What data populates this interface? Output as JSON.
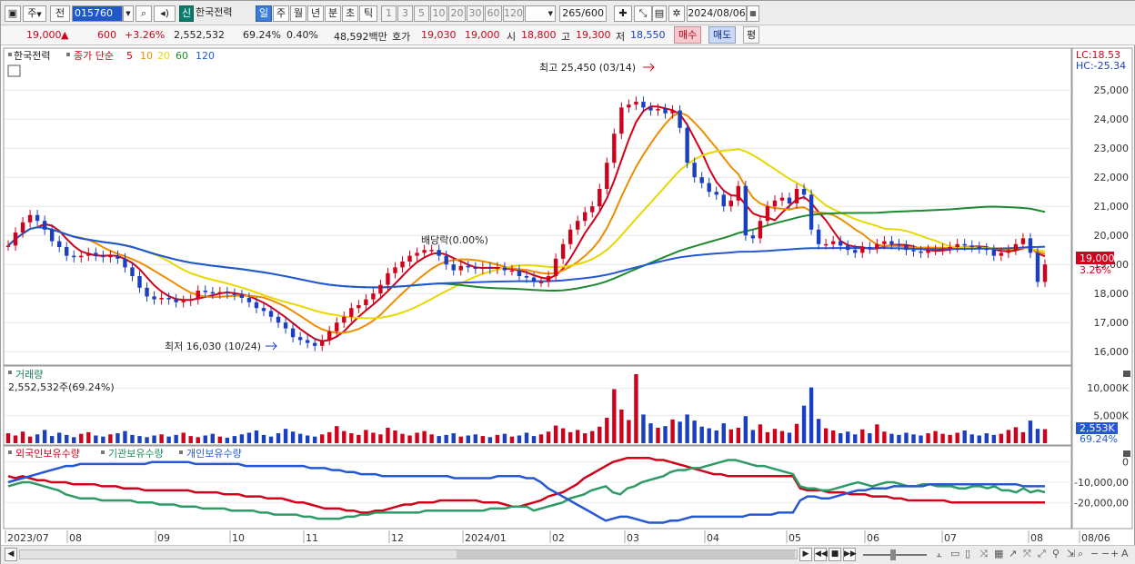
{
  "toolbar": {
    "cycle": "주",
    "jeon": "전",
    "code": "015760",
    "shin": "신",
    "stock_name": "한국전력",
    "periods": [
      "일",
      "주",
      "월",
      "년",
      "분",
      "초",
      "틱"
    ],
    "active_period": "일",
    "counts": [
      "1",
      "3",
      "5",
      "10",
      "20",
      "30",
      "60",
      "120"
    ],
    "view_count": "265",
    "view_total": "/600",
    "date": "2024/08/06"
  },
  "info": {
    "price": "19,000",
    "arrow": "▲",
    "change": "600",
    "change_pct": "+3.26%",
    "volume": "2,552,532",
    "vol_ratio": "69.24%",
    "turnover": "0.40%",
    "amount": "48,592백만",
    "hoga_label": "호가",
    "hoga1": "19,030",
    "hoga2": "19,000",
    "open_label": "시",
    "open": "18,800",
    "high_label": "고",
    "high": "19,300",
    "low_label": "저",
    "low": "18,550",
    "buy": "매수",
    "sell": "매도",
    "pyeong": "평"
  },
  "legend": {
    "name": "한국전력",
    "ma_label": "종가 단순",
    "ma_periods": [
      "5",
      "10",
      "20",
      "60",
      "120"
    ],
    "ma_colors": [
      "#d0021b",
      "#f08c00",
      "#e8d800",
      "#1c8a2e",
      "#2457d6"
    ]
  },
  "annotations": {
    "high": "최고 25,450 (03/14)",
    "low": "최저 16,030 (10/24)",
    "dividend": "배당락(0.00%)",
    "lc": "LC:18.53",
    "hc": "HC:-25.34",
    "price_tag": "19,000",
    "pct_tag": "3.26%"
  },
  "volume_pane": {
    "title": "거래량",
    "value": "2,552,532주(69.24%)",
    "ticks": [
      "10,000K",
      "5,000K"
    ],
    "tag": "2,553K",
    "tag_pct": "69.24%"
  },
  "holdings_pane": {
    "series_names": [
      "외국인보유수량",
      "기관보유수량",
      "개인보유수량"
    ],
    "ticks": [
      "0",
      "-10,000,00",
      "-20,000,00"
    ]
  },
  "x_axis": [
    "2023/07",
    "08",
    "09",
    "10",
    "11",
    "12",
    "2024/01",
    "02",
    "03",
    "04",
    "05",
    "06",
    "07",
    "08",
    "08/06"
  ],
  "chart_data": {
    "type": "line",
    "title": "한국전력",
    "ylim": [
      15600,
      25600
    ],
    "yticks": [
      16000,
      17000,
      18000,
      19000,
      20000,
      21000,
      22000,
      23000,
      24000,
      25000
    ],
    "close": [
      19650,
      20100,
      20450,
      20700,
      20500,
      20200,
      19800,
      19600,
      19300,
      19250,
      19300,
      19400,
      19300,
      19250,
      19300,
      19200,
      18900,
      18600,
      18200,
      17900,
      17800,
      17850,
      17800,
      17700,
      17750,
      17800,
      18100,
      18050,
      18000,
      18050,
      18000,
      17950,
      17850,
      17700,
      17500,
      17400,
      17200,
      17000,
      16800,
      16500,
      16400,
      16300,
      16200,
      16400,
      16700,
      17000,
      17200,
      17500,
      17600,
      17800,
      18000,
      18300,
      18700,
      18900,
      19100,
      19300,
      19400,
      19500,
      19500,
      19300,
      19000,
      18800,
      18950,
      18900,
      18850,
      18900,
      18850,
      18900,
      18800,
      18800,
      18600,
      18550,
      18400,
      18400,
      18600,
      19200,
      19700,
      20200,
      20500,
      20800,
      21000,
      21600,
      22500,
      23500,
      24400,
      24500,
      24600,
      24400,
      24300,
      24350,
      24200,
      24300,
      23700,
      22500,
      22000,
      21800,
      21500,
      21400,
      21000,
      21200,
      21700,
      20000,
      19900,
      20500,
      21000,
      21200,
      21300,
      21100,
      21600,
      21400,
      20200,
      19700,
      19700,
      19800,
      19650,
      19500,
      19400,
      19600,
      19550,
      19700,
      19800,
      19700,
      19650,
      19500,
      19450,
      19400,
      19500,
      19500,
      19550,
      19600,
      19700,
      19650,
      19600,
      19550,
      19500,
      19300,
      19400,
      19500,
      19700,
      19900,
      19400,
      18400,
      19000
    ],
    "volume": [
      1.8,
      1.4,
      2.1,
      1.2,
      1.6,
      2.4,
      1.3,
      1.9,
      1.5,
      1.1,
      1.7,
      2.0,
      1.4,
      1.2,
      1.6,
      1.8,
      2.2,
      1.5,
      1.3,
      1.1,
      1.4,
      1.6,
      1.2,
      1.5,
      1.9,
      1.3,
      1.1,
      1.4,
      1.7,
      1.2,
      1.0,
      1.3,
      1.6,
      1.9,
      2.3,
      1.5,
      1.2,
      1.8,
      2.6,
      2.1,
      1.7,
      1.4,
      1.2,
      1.6,
      2.0,
      3.1,
      2.2,
      1.8,
      1.5,
      2.4,
      1.9,
      1.6,
      2.8,
      2.3,
      1.7,
      1.4,
      1.9,
      2.2,
      1.6,
      1.3,
      1.5,
      1.8,
      1.2,
      1.4,
      1.6,
      1.3,
      1.1,
      1.5,
      1.7,
      1.2,
      1.4,
      1.9,
      1.3,
      1.6,
      2.1,
      3.2,
      2.7,
      2.0,
      2.4,
      1.8,
      2.2,
      3.0,
      4.6,
      9.8,
      6.1,
      4.2,
      12.5,
      5.2,
      3.6,
      2.8,
      3.1,
      4.3,
      3.9,
      5.2,
      4.1,
      3.0,
      2.7,
      2.3,
      3.6,
      2.5,
      2.8,
      4.9,
      2.4,
      3.4,
      2.0,
      2.6,
      2.2,
      1.9,
      3.5,
      6.8,
      10.1,
      4.4,
      2.7,
      2.3,
      1.8,
      2.1,
      1.6,
      2.5,
      1.8,
      3.4,
      2.1,
      1.7,
      1.5,
      1.9,
      1.6,
      1.4,
      1.8,
      2.2,
      1.7,
      1.5,
      1.9,
      2.3,
      1.6,
      1.4,
      1.8,
      1.5,
      1.7,
      2.4,
      2.9,
      2.0,
      4.1,
      2.6,
      2.55
    ],
    "foreign_hold": [
      -7,
      -8,
      -7,
      -8,
      -9,
      -9,
      -10,
      -10,
      -10,
      -11,
      -11,
      -11,
      -11,
      -12,
      -12,
      -12,
      -13,
      -13,
      -13,
      -14,
      -14,
      -14,
      -14,
      -14,
      -14,
      -14,
      -15,
      -15,
      -15,
      -15,
      -16,
      -16,
      -16,
      -17,
      -17,
      -17,
      -18,
      -18,
      -18,
      -19,
      -20,
      -20,
      -21,
      -22,
      -23,
      -23,
      -23,
      -24,
      -24,
      -25,
      -25,
      -24,
      -24,
      -23,
      -22,
      -21,
      -21,
      -20,
      -20,
      -20,
      -19,
      -19,
      -19,
      -19,
      -19,
      -19,
      -20,
      -20,
      -20,
      -21,
      -22,
      -22,
      -21,
      -20,
      -19,
      -17,
      -16,
      -15,
      -13,
      -11,
      -8,
      -6,
      -4,
      -2,
      0,
      1,
      2,
      2,
      2,
      2,
      1,
      1,
      0,
      -1,
      -2,
      -3,
      -4,
      -5,
      -6,
      -6,
      -7,
      -7,
      -7,
      -7,
      -7,
      -7,
      -7,
      -7,
      -7,
      -7,
      -13,
      -14,
      -14,
      -14,
      -15,
      -15,
      -15,
      -16,
      -16,
      -16,
      -17,
      -17,
      -17,
      -18,
      -18,
      -19,
      -19,
      -19,
      -19,
      -19,
      -19,
      -20,
      -20,
      -20,
      -20,
      -20,
      -20,
      -20,
      -20,
      -20,
      -20,
      -20,
      -20,
      -20,
      -20
    ],
    "institution_hold": [
      -12,
      -11,
      -10,
      -10,
      -11,
      -12,
      -13,
      -14,
      -16,
      -17,
      -18,
      -18,
      -18,
      -19,
      -19,
      -19,
      -19,
      -19,
      -20,
      -20,
      -20,
      -21,
      -21,
      -21,
      -22,
      -22,
      -22,
      -23,
      -23,
      -23,
      -23,
      -24,
      -24,
      -24,
      -24,
      -25,
      -25,
      -26,
      -26,
      -26,
      -26,
      -27,
      -27,
      -28,
      -28,
      -28,
      -28,
      -27,
      -27,
      -26,
      -26,
      -25,
      -25,
      -25,
      -25,
      -25,
      -25,
      -25,
      -24,
      -24,
      -24,
      -24,
      -24,
      -24,
      -24,
      -24,
      -24,
      -23,
      -23,
      -23,
      -22,
      -22,
      -22,
      -24,
      -23,
      -22,
      -21,
      -20,
      -18,
      -17,
      -16,
      -14,
      -13,
      -12,
      -15,
      -16,
      -13,
      -12,
      -10,
      -9,
      -8,
      -7,
      -5,
      -4,
      -4,
      -3,
      -3,
      -2,
      -1,
      0,
      1,
      1,
      0,
      -1,
      -2,
      -2,
      -3,
      -4,
      -5,
      -6,
      -12,
      -13,
      -13,
      -14,
      -14,
      -13,
      -12,
      -11,
      -10,
      -11,
      -12,
      -11,
      -10,
      -10,
      -11,
      -12,
      -12,
      -11,
      -11,
      -12,
      -12,
      -12,
      -13,
      -13,
      -12,
      -12,
      -13,
      -12,
      -14,
      -14,
      -15,
      -13,
      -15,
      -14,
      -15
    ],
    "individual_hold": [
      -10,
      -9,
      -8,
      -7,
      -6,
      -5,
      -4,
      -3,
      -2,
      -2,
      -1,
      -1,
      -1,
      -1,
      -1,
      -1,
      -1,
      -1,
      -1,
      -1,
      0,
      0,
      0,
      0,
      0,
      0,
      -1,
      -1,
      -1,
      -1,
      -1,
      -1,
      -1,
      -2,
      -2,
      -2,
      -2,
      -2,
      -2,
      -2,
      -2,
      -2,
      -3,
      -3,
      -3,
      -4,
      -4,
      -5,
      -5,
      -6,
      -6,
      -6,
      -7,
      -7,
      -7,
      -7,
      -7,
      -7,
      -7,
      -7,
      -7,
      -7,
      -8,
      -8,
      -8,
      -8,
      -8,
      -8,
      -7,
      -7,
      -7,
      -7,
      -8,
      -8,
      -10,
      -13,
      -15,
      -17,
      -19,
      -21,
      -23,
      -25,
      -27,
      -29,
      -28,
      -27,
      -27,
      -28,
      -29,
      -30,
      -30,
      -30,
      -29,
      -29,
      -28,
      -27,
      -27,
      -27,
      -27,
      -27,
      -27,
      -27,
      -27,
      -26,
      -26,
      -26,
      -26,
      -25,
      -25,
      -25,
      -19,
      -17,
      -17,
      -18,
      -18,
      -17,
      -16,
      -15,
      -14,
      -14,
      -13,
      -13,
      -13,
      -12,
      -12,
      -12,
      -12,
      -12,
      -11,
      -11,
      -11,
      -11,
      -11,
      -11,
      -11,
      -11,
      -11,
      -11,
      -11,
      -11,
      -11,
      -12,
      -12,
      -12,
      -12
    ]
  }
}
